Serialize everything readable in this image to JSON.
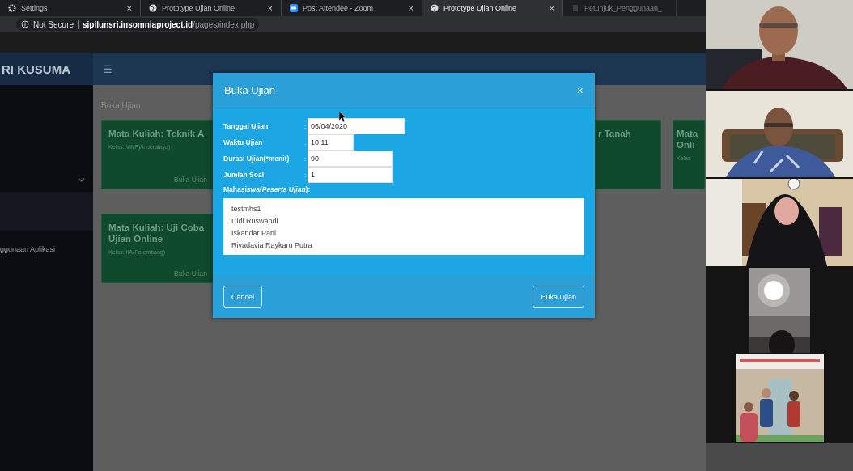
{
  "browser": {
    "tabs": [
      {
        "label": "Settings",
        "close": "×",
        "selected": false
      },
      {
        "label": "Prototype Ujian Online",
        "close": "×",
        "selected": false
      },
      {
        "label": "Post Attendee - Zoom",
        "close": "×",
        "selected": false
      },
      {
        "label": "Prototype Ujian Online",
        "close": "×",
        "selected": true
      },
      {
        "label": "Petunjuk_Penggunaan_",
        "selected": false
      }
    ],
    "security": "Not Secure",
    "url_host": "sipilunsri.insomniaproject.id",
    "url_path": "/pages/index.php"
  },
  "app": {
    "brand": "RI KUSUMA",
    "menu": "☰",
    "sidebar_item": "ggunaan Aplikasi",
    "breadcrumb": "Buka Ujian",
    "cards": [
      {
        "title": "Mata Kuliah: Teknik A",
        "class": "Kelas: VII(P)/Inderalaya)",
        "action": "Buka Ujian"
      },
      {
        "title": "r Tanah"
      },
      {
        "title": "Mata\nOnli",
        "class": "Kelas"
      },
      {
        "title": "Mata Kuliah: Uji Coba Ujian Online",
        "class": "Kelas: IIA(Palembang)",
        "action": "Buka Ujian"
      }
    ]
  },
  "modal": {
    "title": "Buka Ujian",
    "close": "×",
    "fields": [
      {
        "label": "Tanggal Ujian",
        "separator": ":",
        "value": "06/04/2020"
      },
      {
        "label": "Waktu Ujian",
        "separator": ":",
        "value": "10.11"
      },
      {
        "label": "Durasi Ujian(*menit)",
        "separator": ":",
        "value": "90"
      },
      {
        "label": "Jumlah Soal",
        "separator": ":",
        "value": "1"
      }
    ],
    "students_label": "Mahasiswa(*Peserta Ujian*):",
    "students": [
      "testmhs1",
      "Didi Ruswandi",
      "Iskandar Pani",
      "Rivadavia Raykaru Putra"
    ],
    "buttons": [
      "Cancel",
      "Buka Ujian"
    ]
  }
}
